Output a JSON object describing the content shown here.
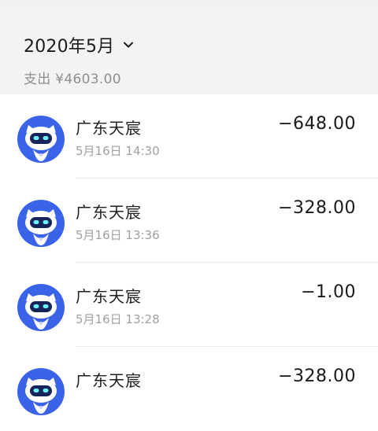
{
  "header": {
    "month": "2020年5月",
    "expense": "支出 ¥4603.00"
  },
  "icons": {
    "chevron": "chevron-down-icon",
    "avatar": "robot-avatar-icon"
  },
  "colors": {
    "avatar_blue": "#3a63e8",
    "avatar_eye": "#6ef1ff",
    "summary_bg": "#f3f3f3"
  },
  "transactions": [
    {
      "merchant": "广东天宸",
      "time": "5月16日 14:30",
      "amount": "−648.00"
    },
    {
      "merchant": "广东天宸",
      "time": "5月16日 13:36",
      "amount": "−328.00"
    },
    {
      "merchant": "广东天宸",
      "time": "5月16日 13:28",
      "amount": "−1.00"
    },
    {
      "merchant": "广东天宸",
      "time": "",
      "amount": "−328.00"
    }
  ]
}
